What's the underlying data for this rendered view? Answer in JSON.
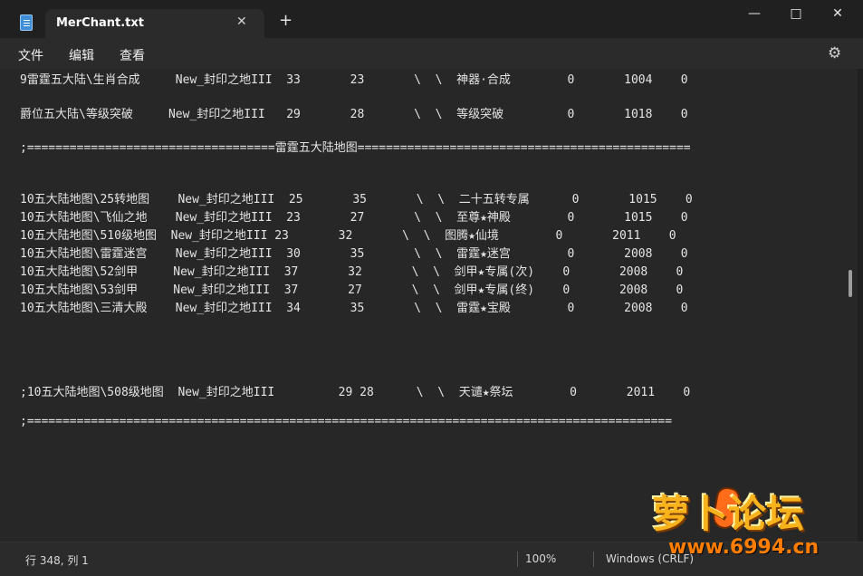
{
  "window": {
    "tab_title": "MerChant.txt",
    "tab_close_icon": "close-icon",
    "new_tab_icon": "plus-icon",
    "minimize_icon": "minimize-icon",
    "maximize_icon": "maximize-icon",
    "close_icon": "close-icon"
  },
  "menu": {
    "items": [
      "文件",
      "编辑",
      "查看"
    ],
    "settings_icon": "gear-icon"
  },
  "editor": {
    "lines": [
      "9雷霆五大陆\\生肖合成     New_封印之地III  33       23       \\  \\  神器·合成        0       1004    0",
      "",
      "爵位五大陆\\等级突破     New_封印之地III   29       28       \\  \\  等级突破         0       1018    0",
      "",
      ";===================================雷霆五大陆地图===============================================",
      "",
      "",
      "10五大陆地图\\25转地图    New_封印之地III  25       35       \\  \\  二十五转专属      0       1015    0",
      "10五大陆地图\\飞仙之地    New_封印之地III  23       27       \\  \\  至尊★神殿        0       1015    0",
      "10五大陆地图\\510级地图  New_封印之地III 23       32       \\  \\  图腾★仙境        0       2011    0",
      "10五大陆地图\\雷霆迷宫    New_封印之地III  30       35       \\  \\  雷霆★迷宫        0       2008    0",
      "10五大陆地图\\52剑甲     New_封印之地III  37       32       \\  \\  剑甲★专属(次)    0       2008    0",
      "10五大陆地图\\53剑甲     New_封印之地III  37       27       \\  \\  剑甲★专属(终)    0       2008    0",
      "10五大陆地图\\三清大殿    New_封印之地III  34       35       \\  \\  雷霆★宝殿        0       2008    0",
      "",
      "",
      "",
      "",
      ";10五大陆地图\\508级地图  New_封印之地III         29 28      \\  \\  天谴★祭坛        0       2011    0",
      "",
      ";==========================================================================================="
    ]
  },
  "status": {
    "position": "行 348, 列 1",
    "zoom": "100%",
    "line_ending": "Windows (CRLF)"
  },
  "watermark": {
    "title": "萝卜论坛",
    "url": "www.6994.cn"
  }
}
